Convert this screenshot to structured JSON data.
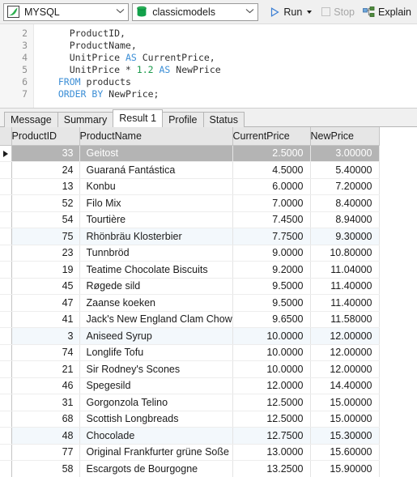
{
  "toolbar": {
    "connection": {
      "icon": "mysql-dolphin-icon",
      "label": "MYSQL"
    },
    "database": {
      "icon": "database-cylinder-icon",
      "label": "classicmodels"
    },
    "run": {
      "icon": "play-triangle-icon",
      "label": "Run"
    },
    "stop": {
      "icon": "stop-square-icon",
      "label": "Stop",
      "enabled": false
    },
    "explain": {
      "icon": "explain-tree-icon",
      "label": "Explain"
    }
  },
  "editor": {
    "lines": [
      {
        "number": "2",
        "tokens": [
          {
            "t": "    ProductID,",
            "c": "plain"
          }
        ]
      },
      {
        "number": "3",
        "tokens": [
          {
            "t": "    ProductName,",
            "c": "plain"
          }
        ]
      },
      {
        "number": "4",
        "tokens": [
          {
            "t": "    UnitPrice ",
            "c": "plain"
          },
          {
            "t": "AS",
            "c": "kw"
          },
          {
            "t": " CurrentPrice,",
            "c": "plain"
          }
        ]
      },
      {
        "number": "5",
        "tokens": [
          {
            "t": "    UnitPrice * ",
            "c": "plain"
          },
          {
            "t": "1.2",
            "c": "num"
          },
          {
            "t": " ",
            "c": "plain"
          },
          {
            "t": "AS",
            "c": "kw"
          },
          {
            "t": " NewPrice",
            "c": "plain"
          }
        ]
      },
      {
        "number": "6",
        "tokens": [
          {
            "t": "  ",
            "c": "plain"
          },
          {
            "t": "FROM",
            "c": "kw"
          },
          {
            "t": " products",
            "c": "plain"
          }
        ]
      },
      {
        "number": "7",
        "tokens": [
          {
            "t": "  ",
            "c": "plain"
          },
          {
            "t": "ORDER BY",
            "c": "kw"
          },
          {
            "t": " NewPrice;",
            "c": "plain"
          }
        ]
      }
    ]
  },
  "tabs": [
    {
      "label": "Message",
      "active": false
    },
    {
      "label": "Summary",
      "active": false
    },
    {
      "label": "Result 1",
      "active": true
    },
    {
      "label": "Profile",
      "active": false
    },
    {
      "label": "Status",
      "active": false
    }
  ],
  "result_grid": {
    "columns": [
      "ProductID",
      "ProductName",
      "CurrentPrice",
      "NewPrice"
    ],
    "selected_row_index": 0,
    "rows": [
      {
        "ProductID": "33",
        "ProductName": "Geitost",
        "CurrentPrice": "2.5000",
        "NewPrice": "3.00000"
      },
      {
        "ProductID": "24",
        "ProductName": "Guaraná Fantástica",
        "CurrentPrice": "4.5000",
        "NewPrice": "5.40000"
      },
      {
        "ProductID": "13",
        "ProductName": "Konbu",
        "CurrentPrice": "6.0000",
        "NewPrice": "7.20000"
      },
      {
        "ProductID": "52",
        "ProductName": "Filo Mix",
        "CurrentPrice": "7.0000",
        "NewPrice": "8.40000"
      },
      {
        "ProductID": "54",
        "ProductName": "Tourtière",
        "CurrentPrice": "7.4500",
        "NewPrice": "8.94000"
      },
      {
        "ProductID": "75",
        "ProductName": "Rhönbräu Klosterbier",
        "CurrentPrice": "7.7500",
        "NewPrice": "9.30000"
      },
      {
        "ProductID": "23",
        "ProductName": "Tunnbröd",
        "CurrentPrice": "9.0000",
        "NewPrice": "10.80000"
      },
      {
        "ProductID": "19",
        "ProductName": "Teatime Chocolate Biscuits",
        "CurrentPrice": "9.2000",
        "NewPrice": "11.04000"
      },
      {
        "ProductID": "45",
        "ProductName": "Røgede sild",
        "CurrentPrice": "9.5000",
        "NewPrice": "11.40000"
      },
      {
        "ProductID": "47",
        "ProductName": "Zaanse koeken",
        "CurrentPrice": "9.5000",
        "NewPrice": "11.40000"
      },
      {
        "ProductID": "41",
        "ProductName": "Jack's New England Clam Chowde",
        "CurrentPrice": "9.6500",
        "NewPrice": "11.58000"
      },
      {
        "ProductID": "3",
        "ProductName": "Aniseed Syrup",
        "CurrentPrice": "10.0000",
        "NewPrice": "12.00000"
      },
      {
        "ProductID": "74",
        "ProductName": "Longlife Tofu",
        "CurrentPrice": "10.0000",
        "NewPrice": "12.00000"
      },
      {
        "ProductID": "21",
        "ProductName": "Sir Rodney's Scones",
        "CurrentPrice": "10.0000",
        "NewPrice": "12.00000"
      },
      {
        "ProductID": "46",
        "ProductName": "Spegesild",
        "CurrentPrice": "12.0000",
        "NewPrice": "14.40000"
      },
      {
        "ProductID": "31",
        "ProductName": "Gorgonzola Telino",
        "CurrentPrice": "12.5000",
        "NewPrice": "15.00000"
      },
      {
        "ProductID": "68",
        "ProductName": "Scottish Longbreads",
        "CurrentPrice": "12.5000",
        "NewPrice": "15.00000"
      },
      {
        "ProductID": "48",
        "ProductName": "Chocolade",
        "CurrentPrice": "12.7500",
        "NewPrice": "15.30000"
      },
      {
        "ProductID": "77",
        "ProductName": "Original Frankfurter grüne Soße",
        "CurrentPrice": "13.0000",
        "NewPrice": "15.60000"
      },
      {
        "ProductID": "58",
        "ProductName": "Escargots de Bourgogne",
        "CurrentPrice": "13.2500",
        "NewPrice": "15.90000"
      }
    ]
  },
  "colors": {
    "keyword": "#3b8ed6",
    "number": "#1a9a4b",
    "accent_run": "#3b7fd4",
    "selection": "#b4b4b4",
    "alt_row": "#f3f8fc",
    "mysql_green": "#2eb050"
  }
}
